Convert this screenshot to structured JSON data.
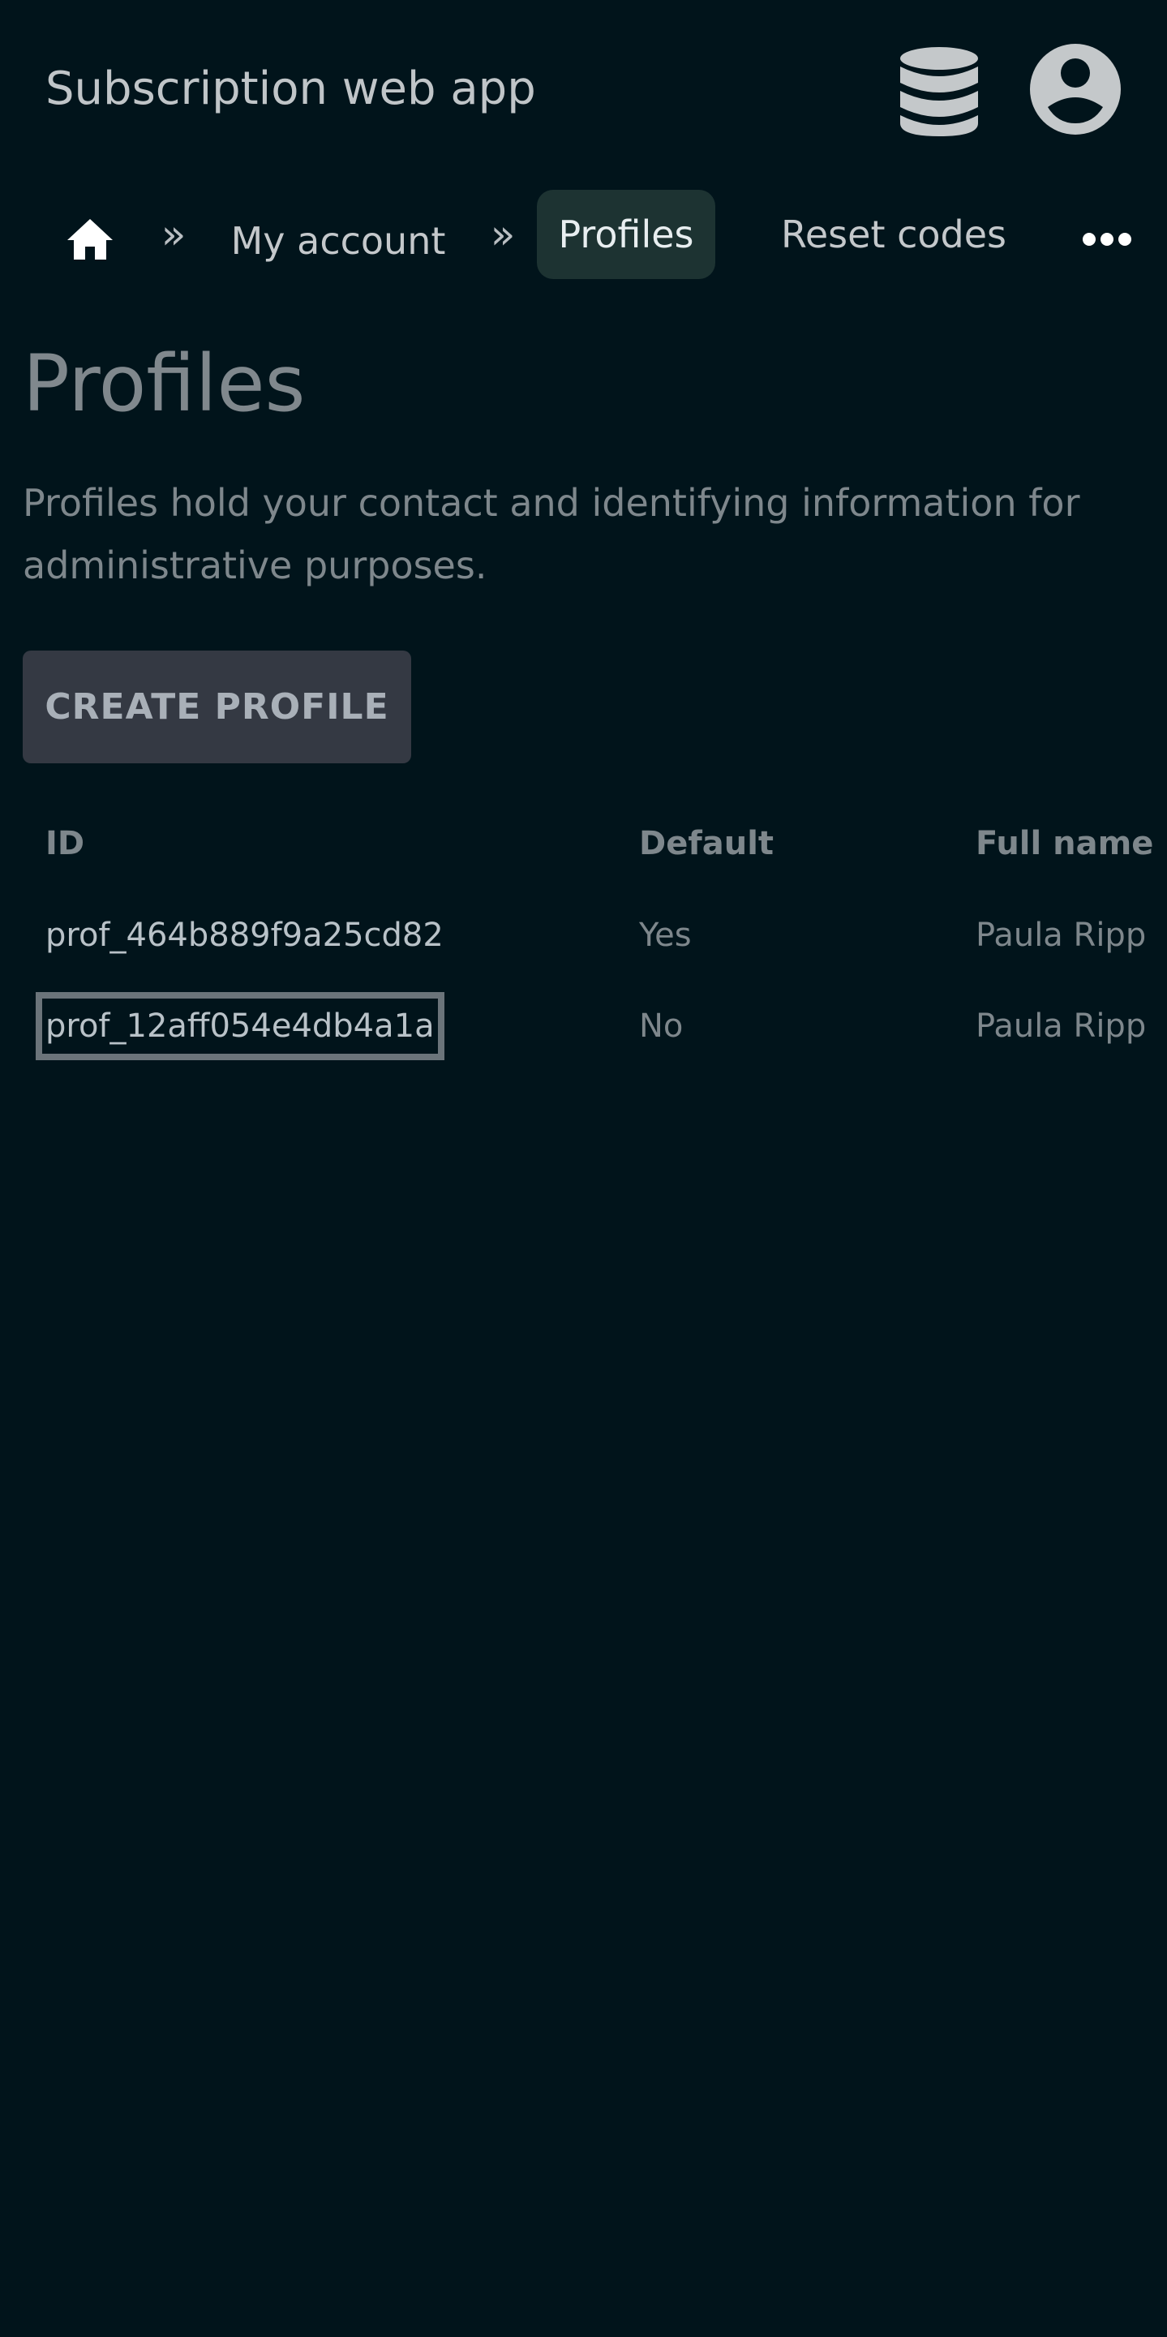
{
  "app": {
    "title": "Subscription web app"
  },
  "header": {
    "icons": [
      "database-icon",
      "user-circle-icon"
    ]
  },
  "nav": {
    "home_icon": "home-icon",
    "separator": "»",
    "items": [
      {
        "label": "My account",
        "active": false
      },
      {
        "label": "Profiles",
        "active": true
      },
      {
        "label": "Reset codes",
        "active": false
      }
    ],
    "more_icon": "ellipsis-icon"
  },
  "page": {
    "title": "Profiles",
    "description": "Profiles hold your contact and identifying information for administrative purposes.",
    "create_button": "CREATE PROFILE"
  },
  "table": {
    "columns": [
      "ID",
      "Default",
      "Full name"
    ],
    "rows": [
      {
        "id": "prof_464b889f9a25cd82",
        "default": "Yes",
        "full_name": "Paula Ripp"
      },
      {
        "id": "prof_12aff054e4db4a1a",
        "default": "No",
        "full_name": "Paula Ripp"
      }
    ]
  },
  "colors": {
    "background": "#01141b",
    "active_tab": "#1d3332",
    "button": "#343943"
  }
}
